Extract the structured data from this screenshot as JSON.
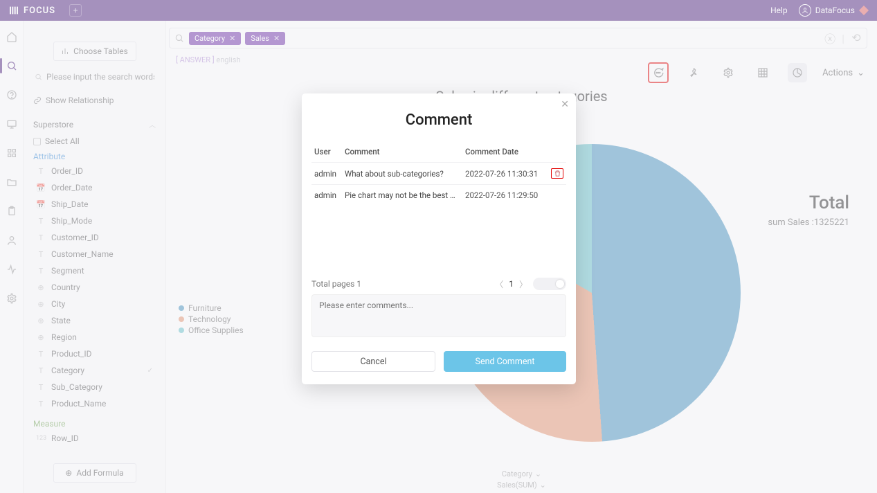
{
  "app": {
    "name": "FOCUS",
    "help": "Help",
    "user": "DataFocus"
  },
  "sidebar": {
    "choose_tables": "Choose Tables",
    "search_placeholder": "Please input the search words",
    "show_relationship": "Show Relationship",
    "datasource": "Superstore",
    "select_all": "Select All",
    "attribute_label": "Attribute",
    "fields": [
      {
        "icon": "T",
        "label": "Order_ID"
      },
      {
        "icon": "📅",
        "label": "Order_Date"
      },
      {
        "icon": "📅",
        "label": "Ship_Date"
      },
      {
        "icon": "T",
        "label": "Ship_Mode"
      },
      {
        "icon": "T",
        "label": "Customer_ID"
      },
      {
        "icon": "T",
        "label": "Customer_Name"
      },
      {
        "icon": "T",
        "label": "Segment"
      },
      {
        "icon": "⊕",
        "label": "Country"
      },
      {
        "icon": "⊕",
        "label": "City"
      },
      {
        "icon": "⊕",
        "label": "State"
      },
      {
        "icon": "⊕",
        "label": "Region"
      },
      {
        "icon": "T",
        "label": "Product_ID"
      },
      {
        "icon": "T",
        "label": "Category",
        "selected": true
      },
      {
        "icon": "T",
        "label": "Sub_Category"
      },
      {
        "icon": "T",
        "label": "Product_Name"
      }
    ],
    "measure_label": "Measure",
    "measures": [
      {
        "icon": "123",
        "label": "Row_ID"
      }
    ],
    "add_formula": "Add Formula"
  },
  "query": {
    "pills": [
      "Category",
      "Sales"
    ],
    "crumb_answer": "[ ANSWER ]",
    "crumb_lang": "english"
  },
  "chart": {
    "title": "Sales in different categories",
    "legend": [
      "Furniture",
      "Technology",
      "Office Supplies"
    ],
    "total_label": "Total",
    "total_sub_prefix": "sum Sales :",
    "total_value": "1325221",
    "footer_dim": "Category",
    "footer_measure": "Sales(SUM)"
  },
  "chart_data": {
    "type": "pie",
    "title": "Sales in different categories",
    "series_name": "sum Sales",
    "total": 1325221,
    "slices": [
      {
        "name": "Furniture",
        "color": "#3f8fbd",
        "approx_share": 0.49
      },
      {
        "name": "Technology",
        "color": "#e5906b",
        "approx_share": 0.34
      },
      {
        "name": "Office Supplies",
        "color": "#63c2c9",
        "approx_share": 0.17
      }
    ]
  },
  "toolbar": {
    "actions": "Actions"
  },
  "modal": {
    "title": "Comment",
    "headers": {
      "user": "User",
      "comment": "Comment",
      "date": "Comment Date"
    },
    "rows": [
      {
        "user": "admin",
        "comment": "What about sub-categories?",
        "date": "2022-07-26 11:30:31",
        "deletable": true
      },
      {
        "user": "admin",
        "comment": "Pie chart may not be the best graph, try bar ch...",
        "date": "2022-07-26 11:29:50",
        "deletable": false
      }
    ],
    "total_pages_label": "Total pages 1",
    "page_current": "1",
    "placeholder": "Please enter comments...",
    "cancel": "Cancel",
    "send": "Send Comment"
  }
}
